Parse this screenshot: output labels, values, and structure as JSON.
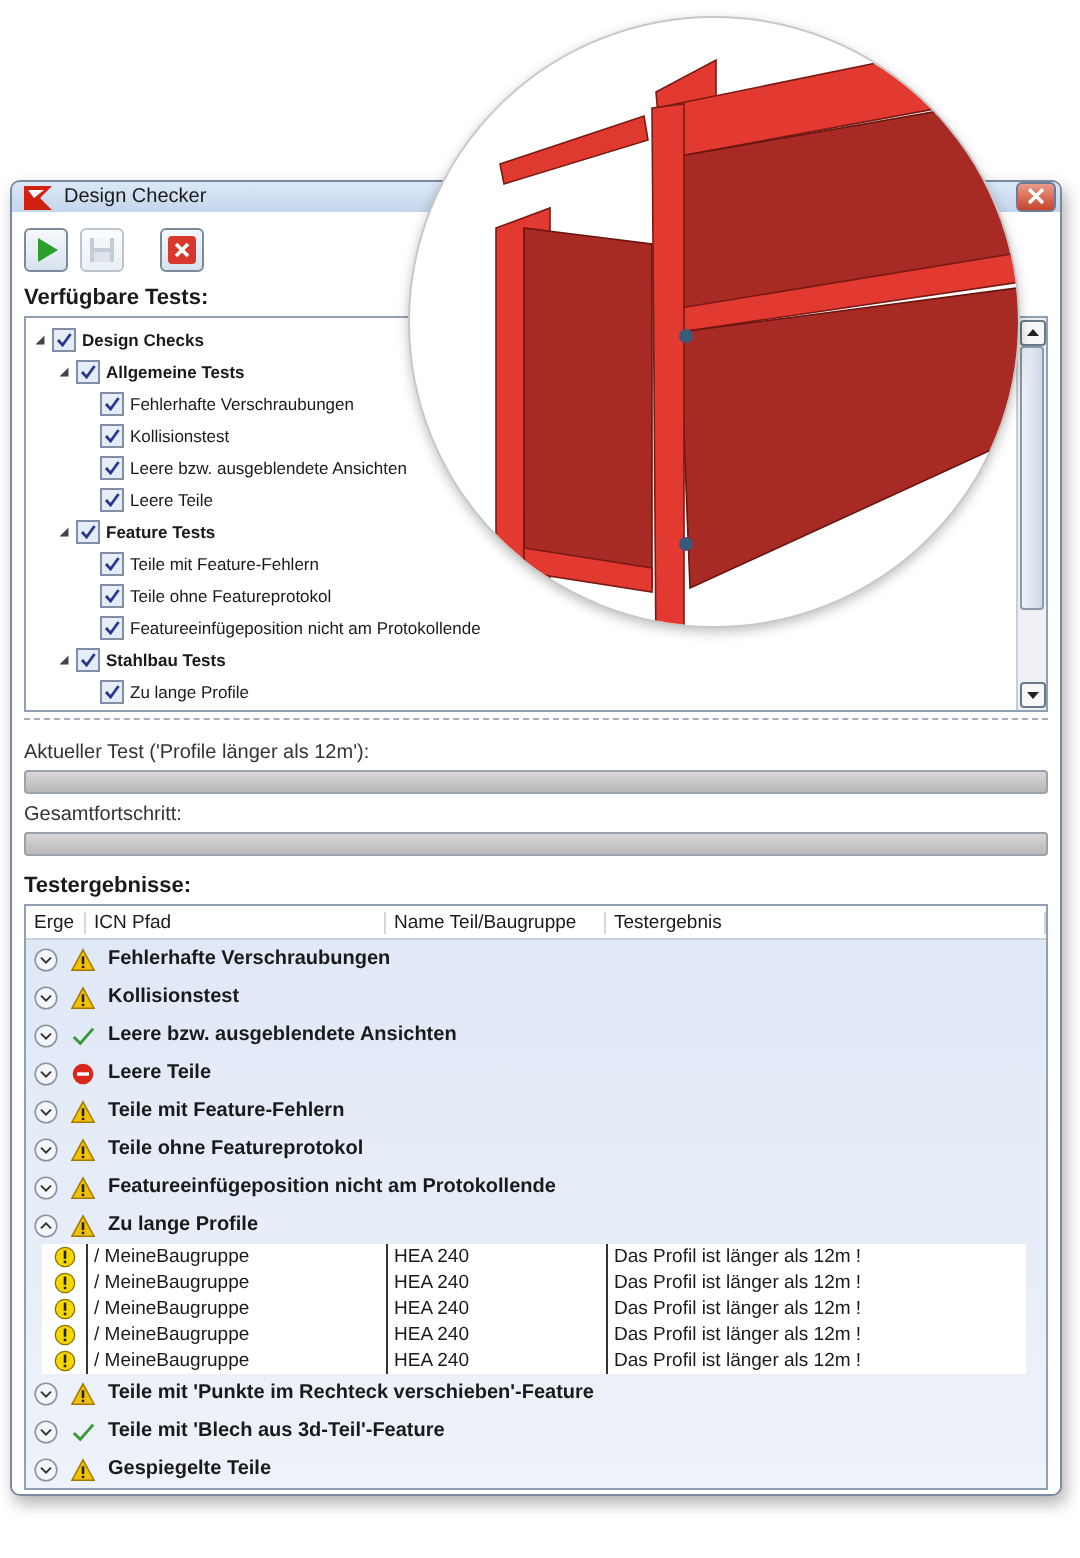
{
  "window": {
    "title": "Design Checker"
  },
  "toolbar": [
    {
      "kind": "run",
      "disabled": false
    },
    {
      "kind": "save",
      "disabled": true
    },
    {
      "kind": "stop",
      "disabled": false
    }
  ],
  "available_tests": {
    "label": "Verfügbare Tests:",
    "tree": [
      {
        "label": "Design Checks",
        "checked": true,
        "expanded": true,
        "children": [
          {
            "label": "Allgemeine Tests",
            "checked": true,
            "expanded": true,
            "children": [
              {
                "label": "Fehlerhafte Verschraubungen",
                "checked": true
              },
              {
                "label": "Kollisionstest",
                "checked": true
              },
              {
                "label": "Leere bzw. ausgeblendete Ansichten",
                "checked": true
              },
              {
                "label": "Leere Teile",
                "checked": true
              }
            ]
          },
          {
            "label": "Feature Tests",
            "checked": true,
            "expanded": true,
            "children": [
              {
                "label": "Teile mit Feature-Fehlern",
                "checked": true
              },
              {
                "label": "Teile ohne Featureprotokol",
                "checked": true
              },
              {
                "label": "Featureeinfügeposition nicht am Protokollende",
                "checked": true
              }
            ]
          },
          {
            "label": "Stahlbau Tests",
            "checked": true,
            "expanded": true,
            "children": [
              {
                "label": "Zu lange Profile",
                "checked": true
              }
            ]
          }
        ]
      }
    ]
  },
  "progress": [
    {
      "label": "Aktueller Test ('Profile länger als 12m'):",
      "level": 0
    },
    {
      "label": "Gesamtfortschritt:",
      "level": 0
    }
  ],
  "results": {
    "label": "Testergebnisse:",
    "columns": [
      "Erge",
      "ICN Pfad",
      "Name Teil/Baugruppe",
      "Testergebnis"
    ],
    "groups": [
      {
        "title": "Fehlerhafte Verschraubungen",
        "kind": "warning",
        "expanded": false
      },
      {
        "title": "Kollisionstest",
        "kind": "warning",
        "expanded": false
      },
      {
        "title": "Leere bzw. ausgeblendete Ansichten",
        "kind": "ok",
        "expanded": false
      },
      {
        "title": "Leere Teile",
        "kind": "error",
        "expanded": false
      },
      {
        "title": "Teile mit Feature-Fehlern",
        "kind": "warning",
        "expanded": false
      },
      {
        "title": "Teile ohne Featureprotokol",
        "kind": "warning",
        "expanded": false
      },
      {
        "title": "Featureeinfügeposition nicht am Protokollende",
        "kind": "warning",
        "expanded": false
      },
      {
        "title": "Zu lange Profile",
        "kind": "warning",
        "expanded": true,
        "rows": [
          {
            "kind": "warning",
            "path": "/ MeineBaugruppe",
            "name": "HEA 240",
            "result": "Das Profil ist länger als 12m !"
          },
          {
            "kind": "warning",
            "path": "/ MeineBaugruppe",
            "name": "HEA 240",
            "result": "Das Profil ist länger als 12m !"
          },
          {
            "kind": "warning",
            "path": "/ MeineBaugruppe",
            "name": "HEA 240",
            "result": "Das Profil ist länger als 12m !"
          },
          {
            "kind": "warning",
            "path": "/ MeineBaugruppe",
            "name": "HEA 240",
            "result": "Das Profil ist länger als 12m !"
          },
          {
            "kind": "warning",
            "path": "/ MeineBaugruppe",
            "name": "HEA 240",
            "result": "Das Profil ist länger als 12m !"
          }
        ]
      },
      {
        "title": "Teile mit 'Punkte im Rechteck verschieben'-Feature",
        "kind": "warning",
        "expanded": false
      },
      {
        "title": "Teile mit 'Blech aus 3d-Teil'-Feature",
        "kind": "ok",
        "expanded": false
      },
      {
        "title": "Gespiegelte Teile",
        "kind": "warning",
        "expanded": false
      }
    ]
  }
}
